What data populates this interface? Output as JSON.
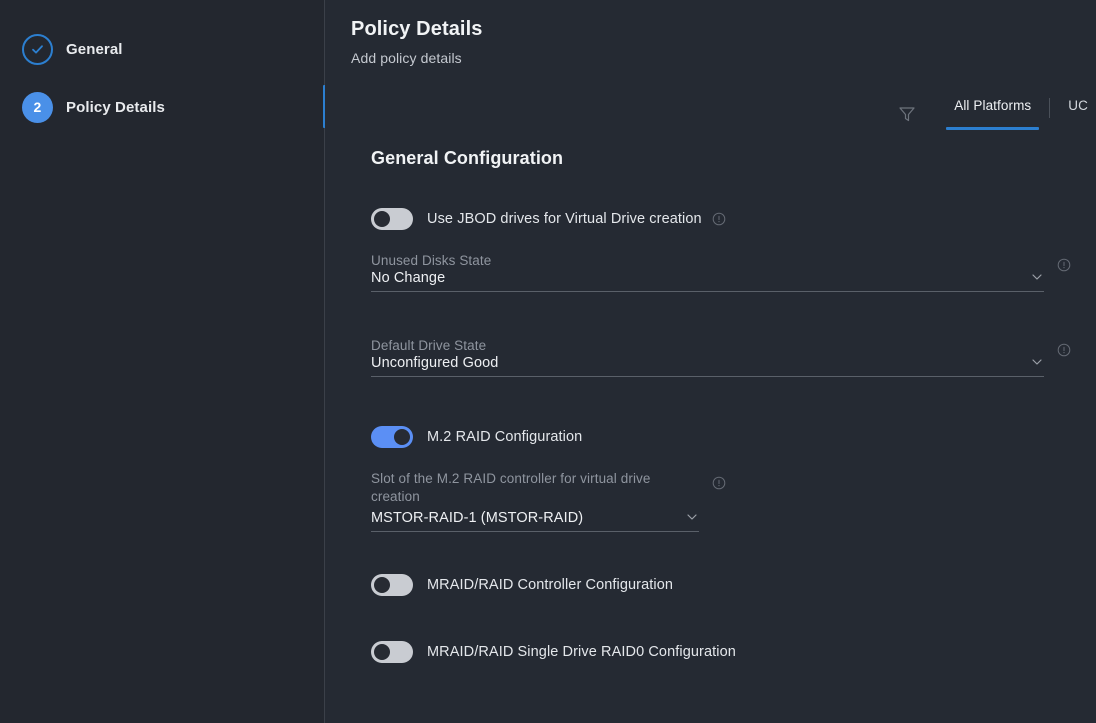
{
  "sidebar": {
    "steps": [
      {
        "label": "General",
        "state": "done",
        "marker": "check-icon"
      },
      {
        "label": "Policy Details",
        "state": "active",
        "marker": "2"
      }
    ]
  },
  "header": {
    "title": "Policy Details",
    "subtitle": "Add policy details"
  },
  "toolbar": {
    "filter_icon": "filter-icon",
    "tabs": [
      {
        "label": "All Platforms",
        "active": true
      },
      {
        "label": "UC",
        "active": false
      }
    ]
  },
  "form": {
    "section_title": "General Configuration",
    "jbod_toggle": {
      "label": "Use JBOD drives for Virtual Drive creation",
      "state": "off",
      "has_info": true
    },
    "unused_disks_state": {
      "label": "Unused Disks State",
      "value": "No Change",
      "has_info": true
    },
    "default_drive_state": {
      "label": "Default Drive State",
      "value": "Unconfigured Good",
      "has_info": true
    },
    "m2_raid_toggle": {
      "label": "M.2 RAID Configuration",
      "state": "on",
      "has_info": false
    },
    "m2_slot": {
      "label": "Slot of the M.2 RAID controller for virtual drive creation",
      "value": "MSTOR-RAID-1 (MSTOR-RAID)",
      "has_info": true
    },
    "mraid_controller_toggle": {
      "label": "MRAID/RAID Controller Configuration",
      "state": "off",
      "has_info": false
    },
    "mraid_single_drive_toggle": {
      "label": "MRAID/RAID Single Drive RAID0 Configuration",
      "state": "off",
      "has_info": false
    }
  },
  "colors": {
    "accent": "#2c7fd0",
    "toggle_on": "#5b8ff5",
    "toggle_off": "#c9ccd2",
    "sidebar_bg": "#23272f",
    "main_bg": "#252a33"
  }
}
